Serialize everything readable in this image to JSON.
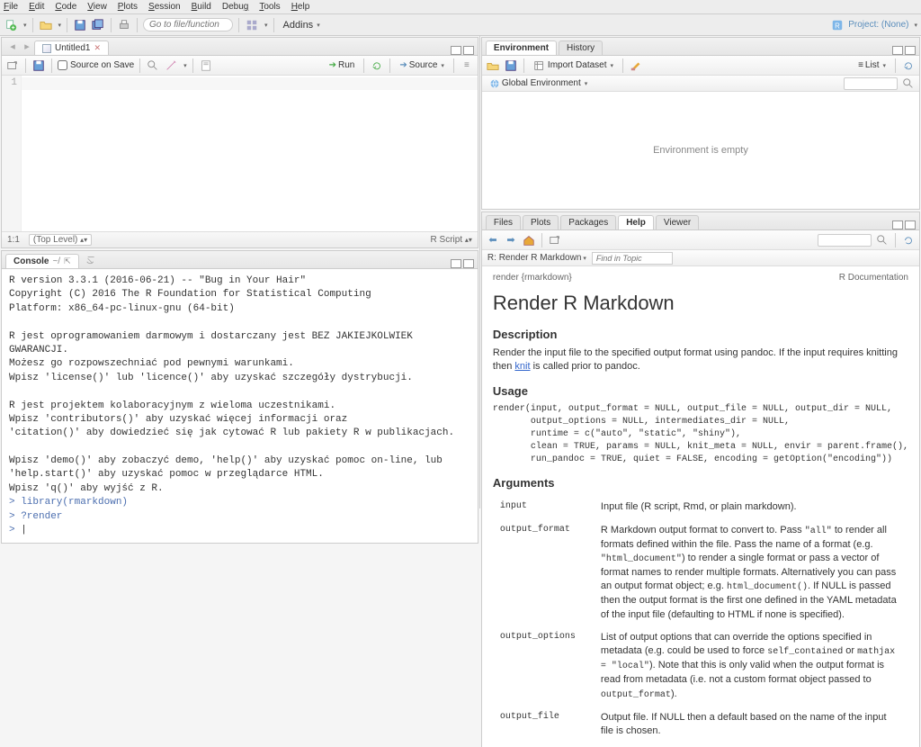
{
  "menu": [
    "File",
    "Edit",
    "Code",
    "View",
    "Plots",
    "Session",
    "Build",
    "Debug",
    "Tools",
    "Help"
  ],
  "project_label": "Project: (None)",
  "addins_label": "Addins",
  "goto_placeholder": "Go to file/function",
  "source_tab": "Untitled1",
  "source_on_save": "Source on Save",
  "run_label": "Run",
  "source_btn": "Source",
  "gutter_line": "1",
  "cursor_pos": "1:1",
  "scope_label": "(Top Level)",
  "script_type": "R Script",
  "console_title": "Console",
  "console_path": "~/",
  "console_text": "R version 3.3.1 (2016-06-21) -- \"Bug in Your Hair\"\nCopyright (C) 2016 The R Foundation for Statistical Computing\nPlatform: x86_64-pc-linux-gnu (64-bit)\n\nR jest oprogramowaniem darmowym i dostarczany jest BEZ JAKIEJKOLWIEK GWARANCJI.\nMożesz go rozpowszechniać pod pewnymi warunkami.\nWpisz 'license()' lub 'licence()' aby uzyskać szczegóły dystrybucji.\n\nR jest projektem kolaboracyjnym z wieloma uczestnikami.\nWpisz 'contributors()' aby uzyskać więcej informacji oraz\n'citation()' aby dowiedzieć się jak cytować R lub pakiety R w publikacjach.\n\nWpisz 'demo()' aby zobaczyć demo, 'help()' aby uzyskać pomoc on-line, lub\n'help.start()' aby uzyskać pomoc w przeglądarce HTML.\nWpisz 'q()' aby wyjść z R.\n",
  "console_cmds": [
    "library(rmarkdown)",
    "?render"
  ],
  "env_tabs": [
    "Environment",
    "History"
  ],
  "import_label": "Import Dataset",
  "list_label": "List",
  "global_env": "Global Environment",
  "env_empty": "Environment is empty",
  "help_tabs": [
    "Files",
    "Plots",
    "Packages",
    "Help",
    "Viewer"
  ],
  "help_breadcrumb": "R: Render R Markdown",
  "find_topic_placeholder": "Find in Topic",
  "help_pkg": "render {rmarkdown}",
  "help_doc": "R Documentation",
  "help": {
    "title": "Render R Markdown",
    "desc_h": "Description",
    "desc": "Render the input file to the specified output format using pandoc. If the input requires knitting then ",
    "desc_link": "knit",
    "desc2": " is called prior to pandoc.",
    "usage_h": "Usage",
    "usage": "render(input, output_format = NULL, output_file = NULL, output_dir = NULL,\n       output_options = NULL, intermediates_dir = NULL,\n       runtime = c(\"auto\", \"static\", \"shiny\"),\n       clean = TRUE, params = NULL, knit_meta = NULL, envir = parent.frame(),\n       run_pandoc = TRUE, quiet = FALSE, encoding = getOption(\"encoding\"))",
    "args_h": "Arguments",
    "args": [
      {
        "n": "input",
        "d": "Input file (R script, Rmd, or plain markdown)."
      },
      {
        "n": "output_format",
        "d": "R Markdown output format to convert to. Pass <code>\"all\"</code> to render all formats defined within the file. Pass the name of a format (e.g. <code>\"html_document\"</code>) to render a single format or pass a vector of format names to render multiple formats. Alternatively you can pass an output format object; e.g. <code>html_document()</code>. If NULL is passed then the output format is the first one defined in the YAML metadata of the input file (defaulting to HTML if none is specified)."
      },
      {
        "n": "output_options",
        "d": "List of output options that can override the options specified in metadata (e.g. could be used to force <code>self_contained</code> or <code>mathjax = \"local\"</code>). Note that this is only valid when the output format is read from metadata (i.e. not a custom format object passed to <code>output_format</code>)."
      },
      {
        "n": "output_file",
        "d": "Output file. If NULL then a default based on the name of the input file is chosen."
      }
    ]
  }
}
